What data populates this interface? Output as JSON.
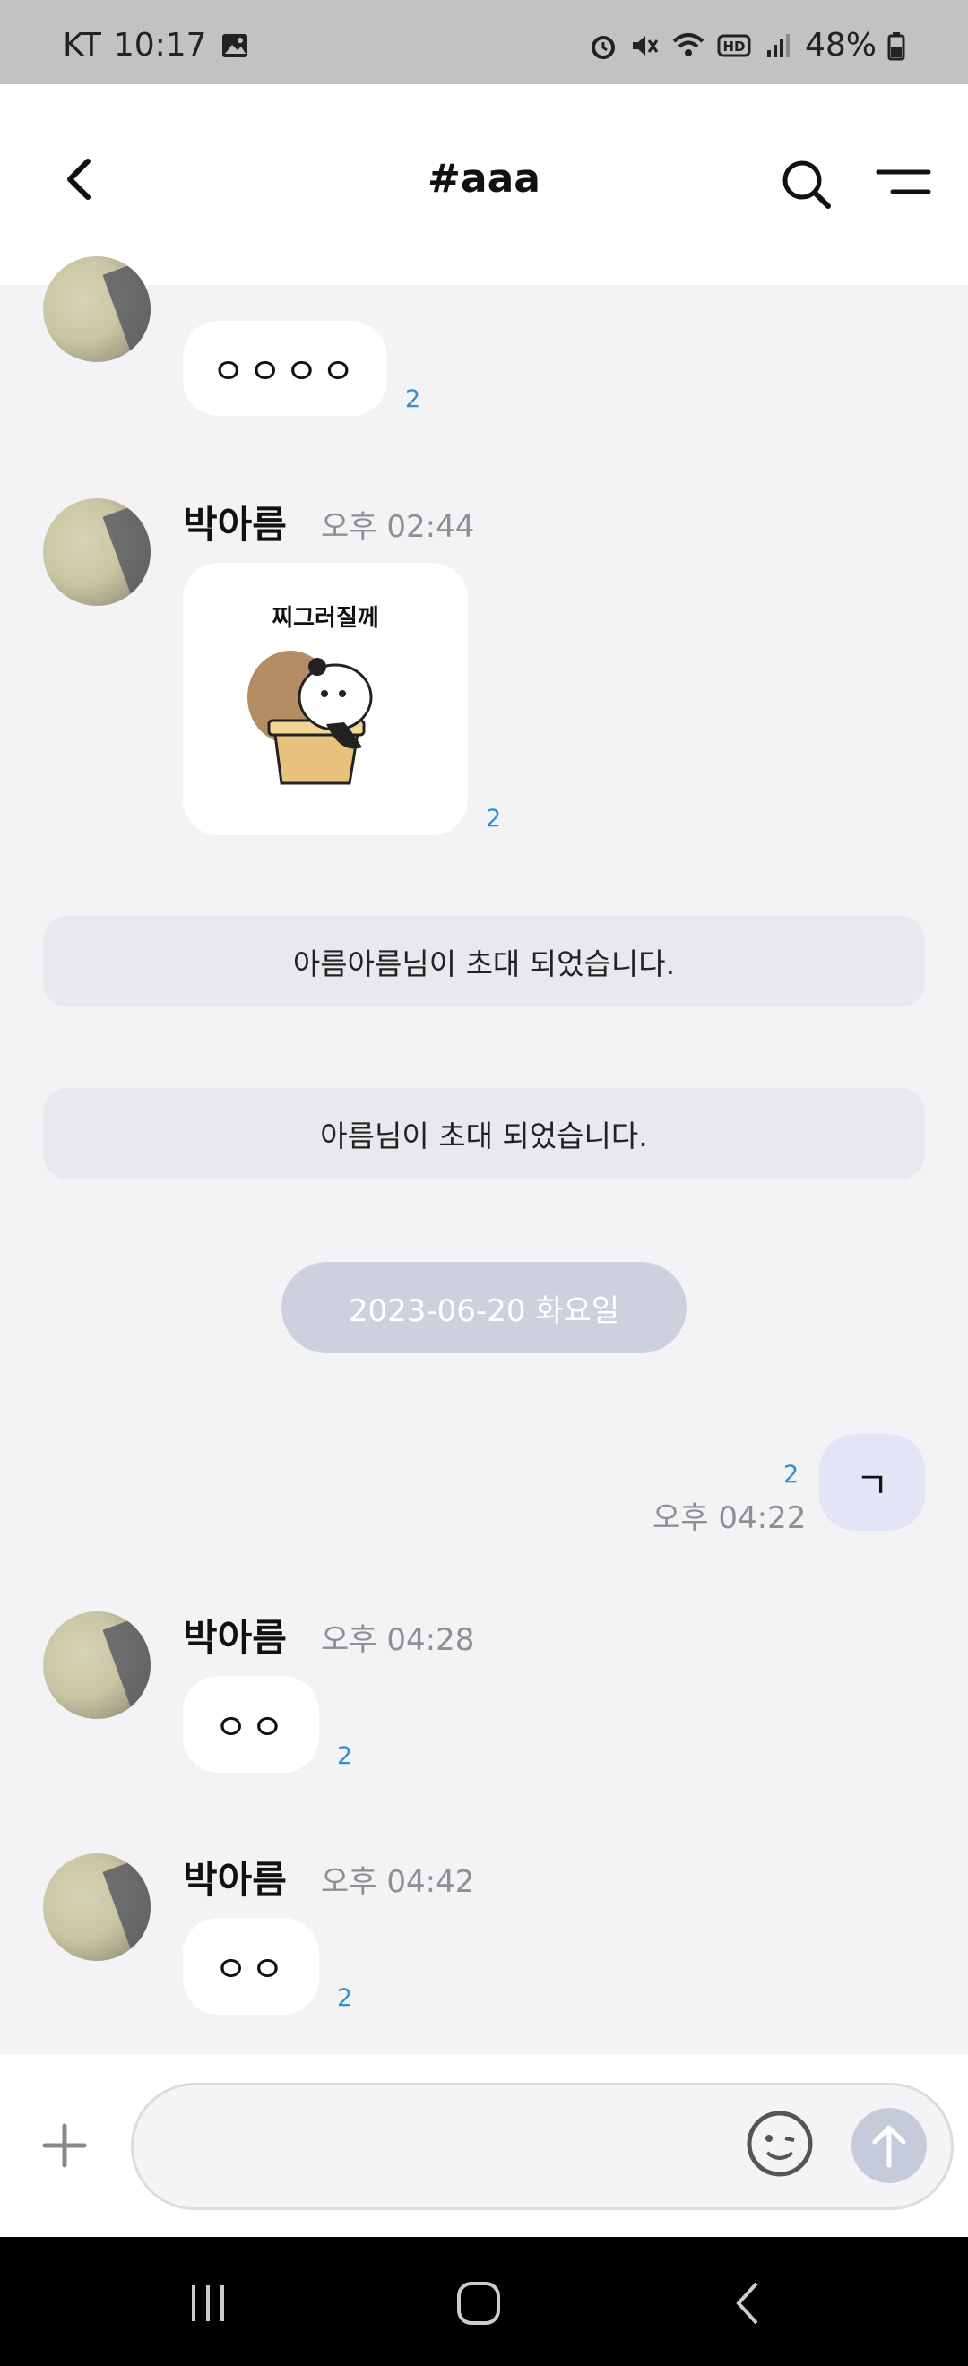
{
  "status_bar": {
    "carrier": "KT",
    "time": "10:17",
    "battery": "48%",
    "icons": [
      "gallery-icon",
      "alarm-icon",
      "mute-icon",
      "wifi-icon",
      "hd-icon",
      "signal-icon",
      "battery-icon"
    ]
  },
  "header": {
    "title": "#aaa"
  },
  "messages": [
    {
      "bubble": "ㅇㅇㅇㅇ",
      "read": "2"
    },
    {
      "name": "박아름",
      "time": "오후 02:44",
      "read": "2",
      "sticker_text": "찌그러질께"
    },
    {
      "name": "박아름",
      "time": "오후 04:28",
      "bubble": "ㅇㅇ",
      "read": "2"
    },
    {
      "name": "박아름",
      "time": "오후 04:42",
      "bubble": "ㅇㅇ",
      "read": "2"
    }
  ],
  "system": [
    "아름아름님이 초대 되었습니다.",
    "아름님이 초대 되었습니다."
  ],
  "date_divider": "2023-06-20 화요일",
  "my_message": {
    "text": "ㄱ",
    "read": "2",
    "time": "오후 04:22"
  },
  "composer": {
    "placeholder": ""
  },
  "colors": {
    "accent_read": "#2f8ed8",
    "my_bubble": "#e3e4f6",
    "background": "#f3f3f6"
  }
}
